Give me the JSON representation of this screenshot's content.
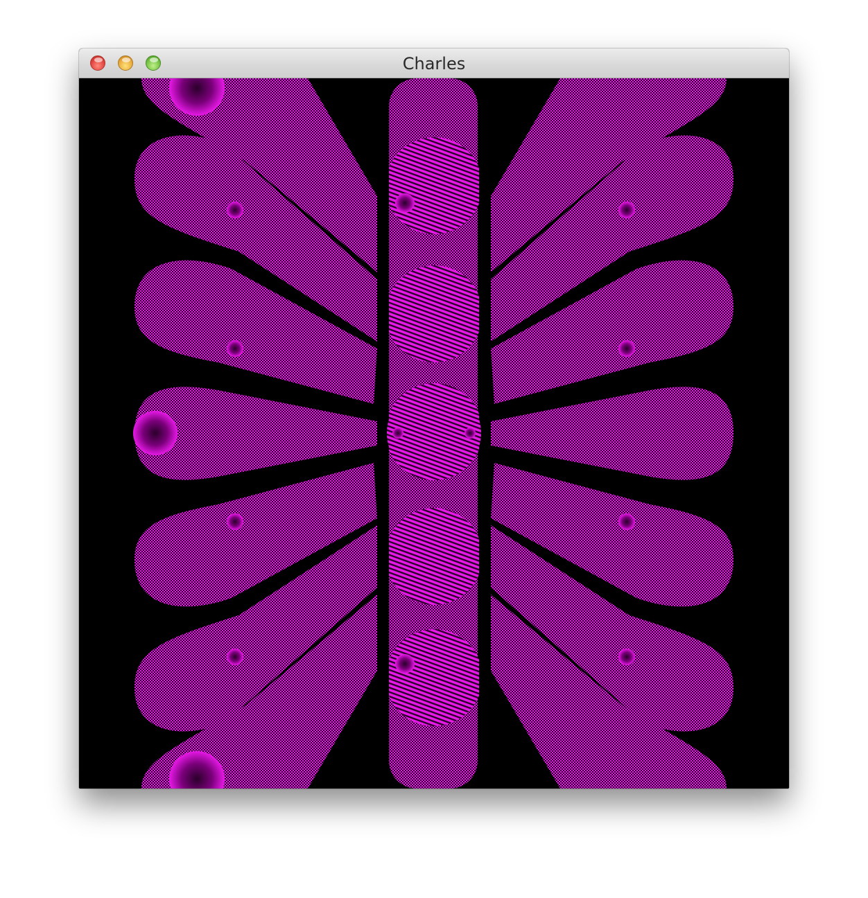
{
  "window": {
    "title": "Charles"
  },
  "canvas": {
    "background_color": "#000000",
    "fill_color": "#e619e6",
    "dark_color": "#3a003a"
  },
  "icons": {
    "close": "close-button",
    "minimize": "minimize-button",
    "zoom": "zoom-button"
  }
}
